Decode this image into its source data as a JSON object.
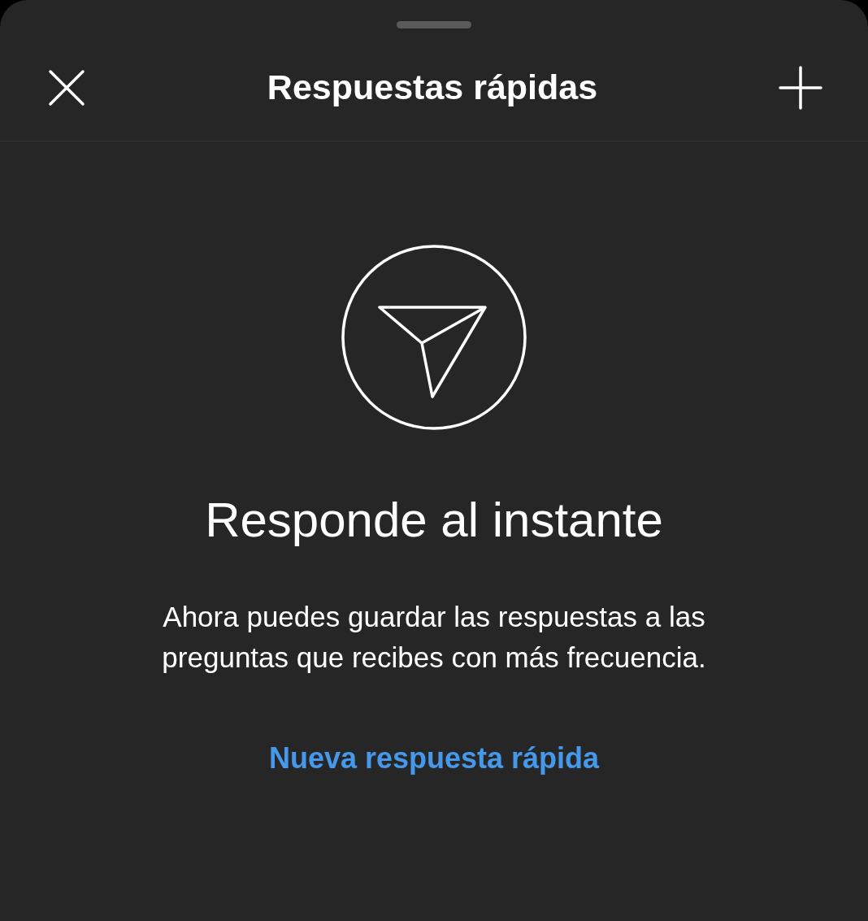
{
  "header": {
    "title": "Respuestas rápidas"
  },
  "empty_state": {
    "heading": "Responde al instante",
    "description": "Ahora puedes guardar las respuestas a las preguntas que recibes con más frecuencia.",
    "link": "Nueva respuesta rápida"
  }
}
